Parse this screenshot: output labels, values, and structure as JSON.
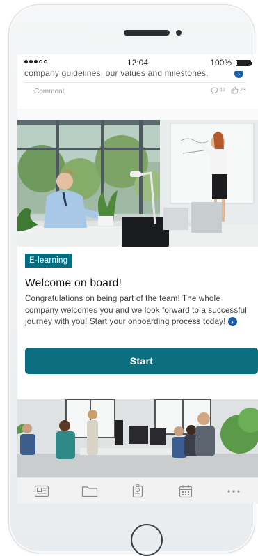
{
  "status_bar": {
    "time": "12:04",
    "battery": "100%"
  },
  "previous_post": {
    "text_fragment": "company guidelines, our values and milestones.",
    "comment_label": "Comment",
    "comment_count": "12",
    "like_count": "23"
  },
  "post": {
    "tag": "E-learning",
    "title": "Welcome on board!",
    "body": "Congratulations on being part of the team! The whole company welcomes you and we look forward to a successful journey with you! Start your onboarding process today!",
    "button_label": "Start"
  },
  "bottom_nav": {
    "items": [
      {
        "icon": "newspaper-icon"
      },
      {
        "icon": "folder-icon"
      },
      {
        "icon": "badge-icon"
      },
      {
        "icon": "calendar-icon"
      },
      {
        "icon": "more-icon"
      }
    ]
  },
  "colors": {
    "accent": "#0b6f80",
    "tag": "#006e80",
    "info": "#1c5ea8",
    "text": "#111111",
    "nav_background": "#f2f2f2"
  }
}
